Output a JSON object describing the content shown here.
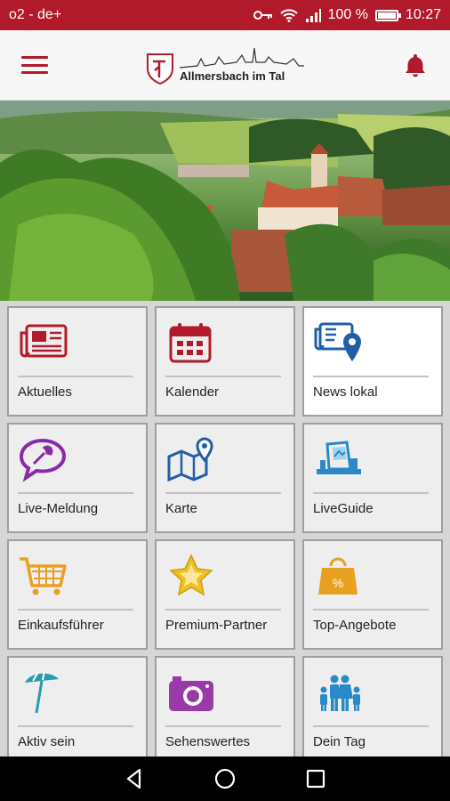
{
  "status": {
    "carrier": "o2 - de+",
    "battery": "100 %",
    "time": "10:27",
    "icons": [
      "key-icon",
      "wifi-icon",
      "signal-icon",
      "battery-icon"
    ]
  },
  "header": {
    "logo_text": "Allmersbach im Tal",
    "icons": [
      "hamburger-menu-icon",
      "bell-icon"
    ],
    "accent": "#b11a2a"
  },
  "tiles": [
    {
      "label": "Aktuelles",
      "icon": "newspaper-icon",
      "color": "#b11a2a"
    },
    {
      "label": "Kalender",
      "icon": "calendar-icon",
      "color": "#b11a2a"
    },
    {
      "label": "News lokal",
      "icon": "local-news-pin-icon",
      "color": "#1f5fa8"
    },
    {
      "label": "Live-Meldung",
      "icon": "wrench-speech-bubble-icon",
      "color": "#8a2aa8"
    },
    {
      "label": "Karte",
      "icon": "map-pin-icon",
      "color": "#1f5fa8"
    },
    {
      "label": "LiveGuide",
      "icon": "liveguide-icon",
      "color": "#2a8ac8"
    },
    {
      "label": "Einkaufsführer",
      "icon": "shopping-cart-icon",
      "color": "#e8a020"
    },
    {
      "label": "Premium-Partner",
      "icon": "star-icon",
      "color": "#f0c020"
    },
    {
      "label": "Top-Angebote",
      "icon": "percent-bag-icon",
      "color": "#e8a020"
    },
    {
      "label": "Aktiv sein",
      "icon": "beach-umbrella-icon",
      "color": "#2a9ab0"
    },
    {
      "label": "Sehenswertes",
      "icon": "camera-icon",
      "color": "#9a3aa8"
    },
    {
      "label": "Dein Tag",
      "icon": "family-icon",
      "color": "#2a8ac8"
    }
  ],
  "nav": [
    "back-icon",
    "home-icon",
    "recents-icon"
  ]
}
